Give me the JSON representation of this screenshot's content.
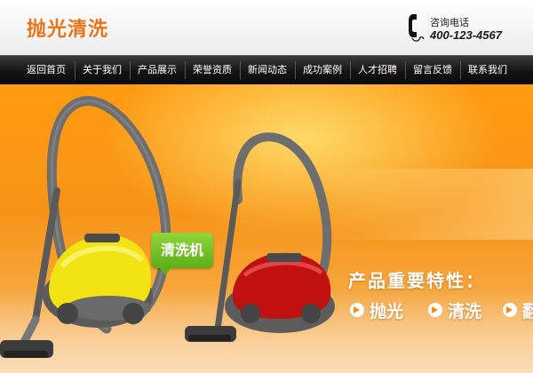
{
  "header": {
    "logo_text": "抛光清洗",
    "phone_title": "咨询电话",
    "phone_number": "400-123-4567",
    "phone_icon": "phone-icon"
  },
  "nav": {
    "items": [
      {
        "label": "返回首页"
      },
      {
        "label": "关于我们"
      },
      {
        "label": "产品展示"
      },
      {
        "label": "荣誉资质"
      },
      {
        "label": "新闻动态"
      },
      {
        "label": "成功案例"
      },
      {
        "label": "人才招聘"
      },
      {
        "label": "留言反馈"
      },
      {
        "label": "联系我们"
      }
    ]
  },
  "banner": {
    "callout": "清洗机",
    "heading": "产品重要特性：",
    "features": [
      "抛光",
      "清洗",
      "翻"
    ]
  },
  "colors": {
    "logo": "#e8741a",
    "banner_orange": "#f79418",
    "callout_green": "#6fbe22",
    "nav_dark": "#141414"
  }
}
